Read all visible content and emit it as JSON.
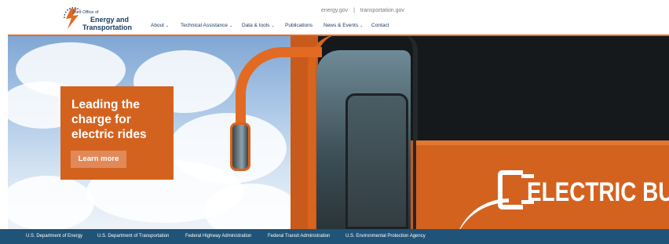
{
  "logo": {
    "line1": "Joint Office of",
    "line2": "Energy and",
    "line3": "Transportation",
    "icon": "lightning-bolt-logo-icon"
  },
  "utility_links": {
    "energy": "energy.gov",
    "separator": "|",
    "transportation": "transportation.gov"
  },
  "nav": {
    "items": [
      {
        "label": "About",
        "has_dropdown": true
      },
      {
        "label": "Technical Assistance",
        "has_dropdown": true
      },
      {
        "label": "Data & tools",
        "has_dropdown": true
      },
      {
        "label": "Publications",
        "has_dropdown": false
      },
      {
        "label": "News & Events",
        "has_dropdown": true
      },
      {
        "label": "Contact",
        "has_dropdown": false
      }
    ],
    "chevron": "⌄"
  },
  "hero": {
    "title": "Leading the charge for electric rides",
    "button_label": "Learn more",
    "bus_text": "ELECTRIC BUS",
    "accent_color": "#d4621f"
  },
  "footer": {
    "links": [
      "U.S. Department of Energy",
      "U.S. Department of Transportation",
      "Federal Highway Administration",
      "Federal Transit Administration",
      "U.S. Environmental Protection Agency"
    ],
    "background_color": "#1f5377"
  }
}
